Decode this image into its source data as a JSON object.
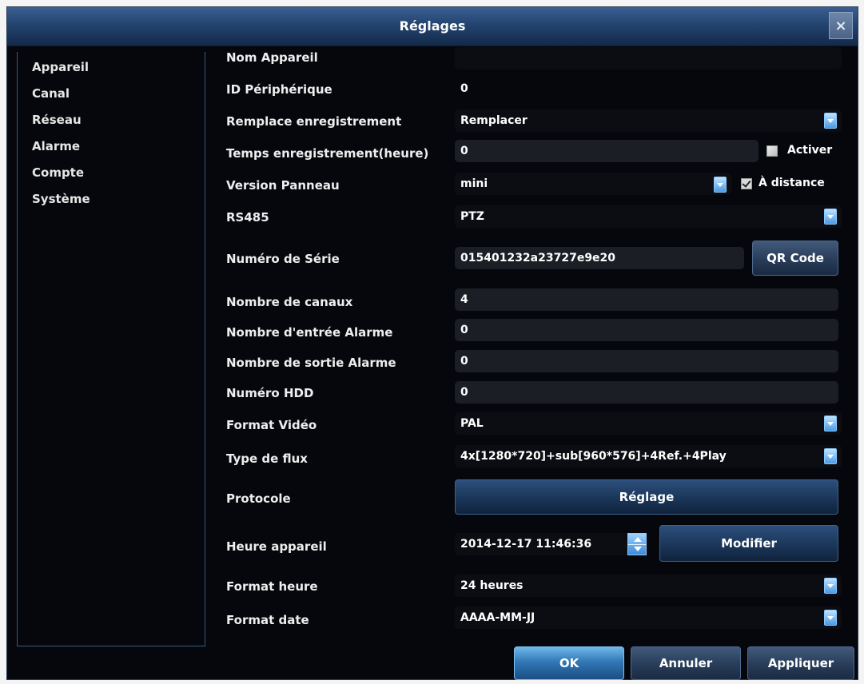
{
  "window": {
    "title": "Réglages",
    "close_glyph": "×"
  },
  "sidebar": {
    "items": [
      {
        "label": "Appareil"
      },
      {
        "label": "Canal"
      },
      {
        "label": "Réseau"
      },
      {
        "label": "Alarme"
      },
      {
        "label": "Compte"
      },
      {
        "label": "Système"
      }
    ]
  },
  "form": {
    "device_name": {
      "label": "Nom Appareil",
      "value": ""
    },
    "device_id": {
      "label": "ID Périphérique",
      "value": "0"
    },
    "overwrite": {
      "label": "Remplace enregistrement",
      "value": "Remplacer"
    },
    "record_time": {
      "label": "Temps enregistrement(heure)",
      "value": "0",
      "checkbox_label": "Activer",
      "checked": false
    },
    "panel_version": {
      "label": "Version Panneau",
      "value": "mini",
      "checkbox_label": "À distance",
      "checked": true
    },
    "rs485": {
      "label": "RS485",
      "value": "PTZ"
    },
    "serial": {
      "label": "Numéro de Série",
      "value": "015401232a23727e9e20",
      "button": "QR Code"
    },
    "channels": {
      "label": "Nombre de canaux",
      "value": "4"
    },
    "alarm_in": {
      "label": "Nombre d'entrée Alarme",
      "value": "0"
    },
    "alarm_out": {
      "label": "Nombre de sortie Alarme",
      "value": "0"
    },
    "hdd": {
      "label": "Numéro HDD",
      "value": "0"
    },
    "video_format": {
      "label": "Format Vidéo",
      "value": "PAL"
    },
    "stream_type": {
      "label": "Type de flux",
      "value": "4x[1280*720]+sub[960*576]+4Ref.+4Play"
    },
    "protocol": {
      "label": "Protocole",
      "button": "Réglage"
    },
    "device_time": {
      "label": "Heure appareil",
      "value": "2014-12-17 11:46:36",
      "button": "Modifier"
    },
    "time_format": {
      "label": "Format heure",
      "value": "24 heures"
    },
    "date_format": {
      "label": "Format date",
      "value": "AAAA-MM-JJ"
    }
  },
  "footer": {
    "ok": "OK",
    "cancel": "Annuler",
    "apply": "Appliquer"
  },
  "colors": {
    "background": "#05070c",
    "title_bar": "#23446f",
    "field": "#1b1e24",
    "accent": "#4b9ae6"
  }
}
